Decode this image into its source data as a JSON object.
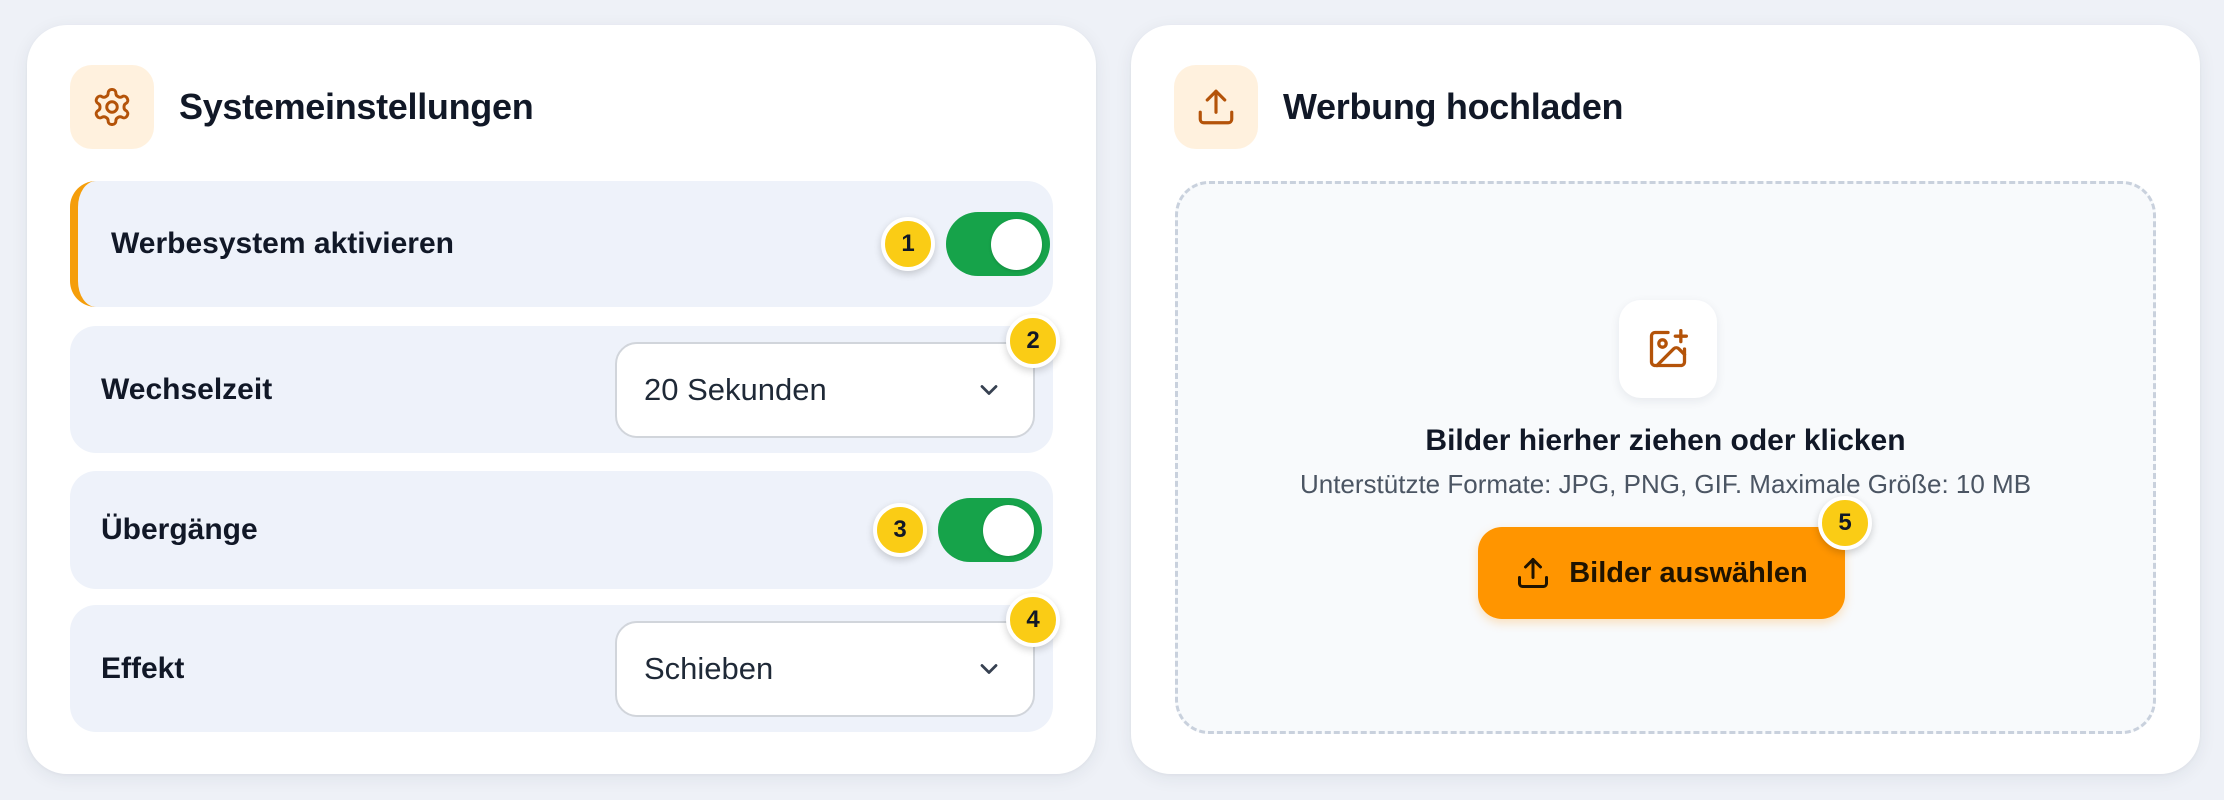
{
  "settings": {
    "title": "Systemeinstellungen",
    "icon": "gear-icon",
    "rows": [
      {
        "label": "Werbesystem aktivieren",
        "type": "toggle",
        "on": true,
        "badge": "1"
      },
      {
        "label": "Wechselzeit",
        "type": "select",
        "value": "20 Sekunden",
        "badge": "2"
      },
      {
        "label": "Übergänge",
        "type": "toggle",
        "on": true,
        "badge": "3"
      },
      {
        "label": "Effekt",
        "type": "select",
        "value": "Schieben",
        "badge": "4"
      }
    ]
  },
  "upload": {
    "title": "Werbung hochladen",
    "icon": "upload-icon",
    "dropzone": {
      "icon": "image-plus-icon",
      "title": "Bilder hierher ziehen oder klicken",
      "subtitle": "Unterstützte Formate: JPG, PNG, GIF. Maximale Größe: 10 MB",
      "button_label": "Bilder auswählen",
      "button_icon": "upload-icon",
      "badge": "5"
    }
  },
  "colors": {
    "page_bg": "#eef1f7",
    "accent": "#ff9500",
    "accent_bar": "#f59e0b",
    "toggle_on": "#16a34a",
    "badge": "#facc15",
    "icon": "#b45309"
  }
}
